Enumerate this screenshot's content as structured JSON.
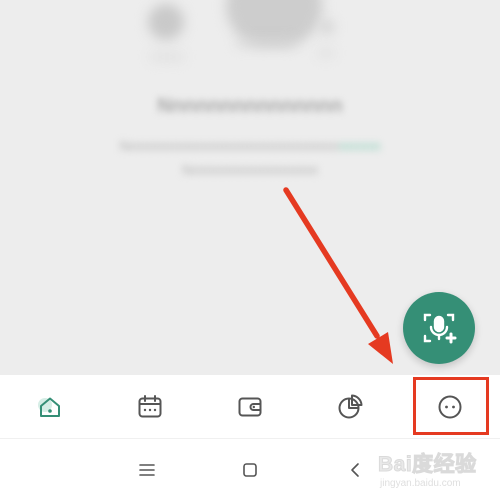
{
  "empty_state": {
    "title": "Nnnnnnnnnnnnnnn",
    "description_line_1": "Nnnnnnnnnnnnnnnnnnnnnnnnnn",
    "description_link": "nnnnn",
    "description_line_2": "Nnnnnnnnnnnnnnnn"
  },
  "fab": {
    "icon": "voice-add-icon",
    "color": "#358f76"
  },
  "tab_bar": {
    "active_index": 0,
    "active_color": "#358f76",
    "tabs": [
      {
        "icon": "home-icon"
      },
      {
        "icon": "calendar-icon"
      },
      {
        "icon": "wallet-icon"
      },
      {
        "icon": "pie-chart-icon"
      },
      {
        "icon": "more-icon"
      }
    ]
  },
  "annotation": {
    "color": "#e53a21",
    "target": "tab-more"
  },
  "system_nav": {
    "buttons": [
      "menu-icon",
      "home-square-icon",
      "back-icon"
    ]
  },
  "watermark": {
    "main": "Bai度经验",
    "sub": "jingyan.baidu.com"
  }
}
